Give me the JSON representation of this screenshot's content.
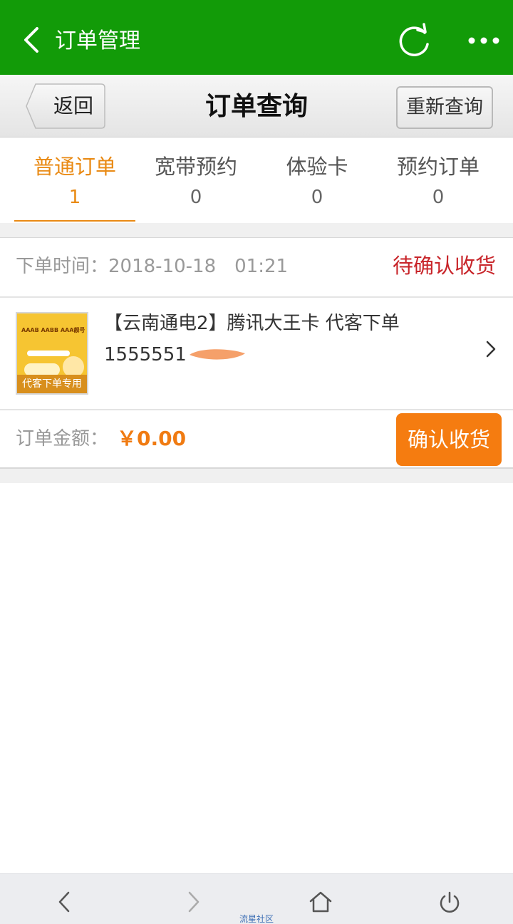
{
  "app_bar": {
    "title": "订单管理",
    "back_icon": "chevron-left-icon",
    "refresh_icon": "refresh-icon",
    "more_icon": "more-dots-icon",
    "color": "#129b08"
  },
  "sub_header": {
    "back_label": "返回",
    "title": "订单查询",
    "requery_label": "重新查询"
  },
  "tabs": [
    {
      "label": "普通订单",
      "count": "1",
      "active": true
    },
    {
      "label": "宽带预约",
      "count": "0",
      "active": false
    },
    {
      "label": "体验卡",
      "count": "0",
      "active": false
    },
    {
      "label": "预约订单",
      "count": "0",
      "active": false
    }
  ],
  "order": {
    "time_label": "下单时间：",
    "time_value": "2018-10-18　01:21",
    "status": "待确认收货",
    "thumbnail": {
      "line1": "AAAB AABB AAA靓号",
      "badge": "代客下单专用"
    },
    "product_title": "【云南通电2】腾讯大王卡 代客下单",
    "product_phone": "1555551",
    "amount_label": "订单金额：",
    "amount_value": "￥0.00",
    "confirm_label": "确认收货",
    "accent_color": "#f57c10",
    "status_color": "#c8252a"
  },
  "bottom_nav": {
    "back_icon": "browser-back-icon",
    "forward_icon": "browser-forward-icon",
    "home_icon": "home-icon",
    "power_icon": "power-icon",
    "watermark": "流星社区"
  }
}
